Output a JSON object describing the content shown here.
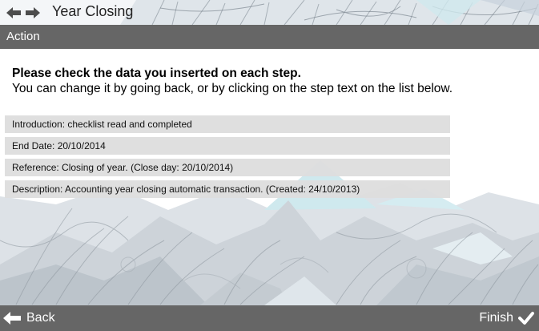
{
  "header": {
    "title": "Year Closing",
    "back_icon": "arrow-left-icon",
    "forward_icon": "arrow-right-icon"
  },
  "action_bar": {
    "label": "Action"
  },
  "main": {
    "heading": "Please check the data you inserted on each step.",
    "subheading": "You can change it by going back, or by clicking on the step text on the list below.",
    "steps": [
      {
        "label": "Introduction: checklist read and completed"
      },
      {
        "label": "End Date: 20/10/2014"
      },
      {
        "label": "Reference: Closing of year. (Close day: 20/10/2014)"
      },
      {
        "label": "Description: Accounting year closing automatic transaction. (Created: 24/10/2013)"
      }
    ]
  },
  "footer": {
    "back_label": "Back",
    "back_icon": "arrow-left-icon",
    "finish_label": "Finish",
    "finish_icon": "checkmark-icon"
  },
  "colors": {
    "bar": "#666666",
    "step_background": "#dddddd",
    "accent_light_blue": "#cfe9ee"
  }
}
